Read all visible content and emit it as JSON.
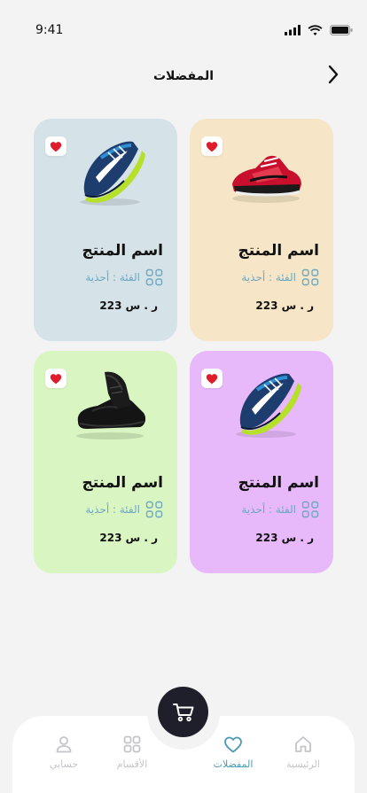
{
  "status_bar": {
    "time": "9:41"
  },
  "header": {
    "title": "المفضلات"
  },
  "products": [
    {
      "name": "اسم المنتج",
      "category": "الفئة : أحذية",
      "price": "223 ر . س",
      "bg": "#f6e6c7",
      "image": "red-sneaker"
    },
    {
      "name": "اسم المنتج",
      "category": "الفئة : أحذية",
      "price": "223 ر . س",
      "bg": "#d5e3e8",
      "image": "blue-running-shoe"
    },
    {
      "name": "اسم المنتج",
      "category": "الفئة : أحذية",
      "price": "223 ر . س",
      "bg": "#e8b9fa",
      "image": "blue-running-shoe"
    },
    {
      "name": "اسم المنتج",
      "category": "الفئة : أحذية",
      "price": "223 ر . س",
      "bg": "#d9f6c2",
      "image": "black-leather-shoe"
    }
  ],
  "colors": {
    "accent": "#4c9bb5",
    "heart": "#e01b2b",
    "fab": "#1f1f2b",
    "category_text": "#6fa7bf"
  },
  "nav": {
    "items": [
      {
        "label": "الرئيسية",
        "icon": "home-icon",
        "active": false
      },
      {
        "label": "المفضلات",
        "icon": "heart-icon",
        "active": true
      },
      {
        "label": "الأقسام",
        "icon": "grid-icon",
        "active": false
      },
      {
        "label": "حسابي",
        "icon": "user-icon",
        "active": false
      }
    ],
    "cart_icon": "cart-icon"
  }
}
